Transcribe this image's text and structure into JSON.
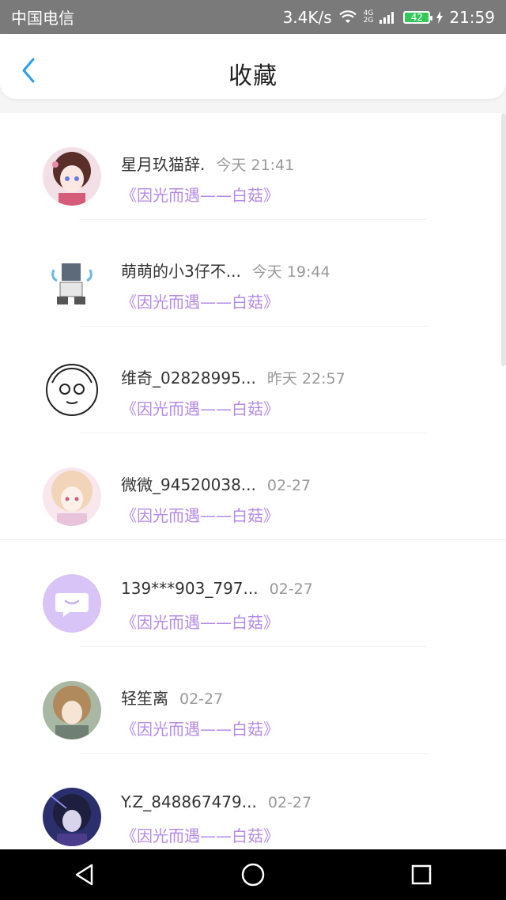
{
  "status_bar": {
    "carrier": "中国电信",
    "speed": "3.4K/s",
    "network_top": "4G",
    "network_bottom": "2G",
    "battery": "42",
    "time": "21:59"
  },
  "header": {
    "title": "收藏",
    "back_icon": "chevron-left-icon"
  },
  "colors": {
    "accent_blue": "#2a9df4",
    "source_purple": "#b48ae6",
    "status_bar_bg": "#7a7a7a"
  },
  "favorites": [
    {
      "name": "星月玖猫辞.",
      "time": "今天 21:41",
      "source": "《因光而遇——白菇》"
    },
    {
      "name": "萌萌的小3仔不...",
      "time": "今天 19:44",
      "source": "《因光而遇——白菇》"
    },
    {
      "name": "维奇_02828995...",
      "time": "昨天 22:57",
      "source": "《因光而遇——白菇》"
    },
    {
      "name": "微微_94520038...",
      "time": "02-27",
      "source": "《因光而遇——白菇》"
    },
    {
      "name": "139***903_797...",
      "time": "02-27",
      "source": "《因光而遇——白菇》"
    },
    {
      "name": "轻笙离",
      "time": "02-27",
      "source": "《因光而遇——白菇》"
    },
    {
      "name": "Y.Z_848867479...",
      "time": "02-27",
      "source": "《因光而遇——白菇》"
    }
  ],
  "navbar": {
    "back": "triangle-back-icon",
    "home": "circle-home-icon",
    "recents": "square-recents-icon"
  }
}
